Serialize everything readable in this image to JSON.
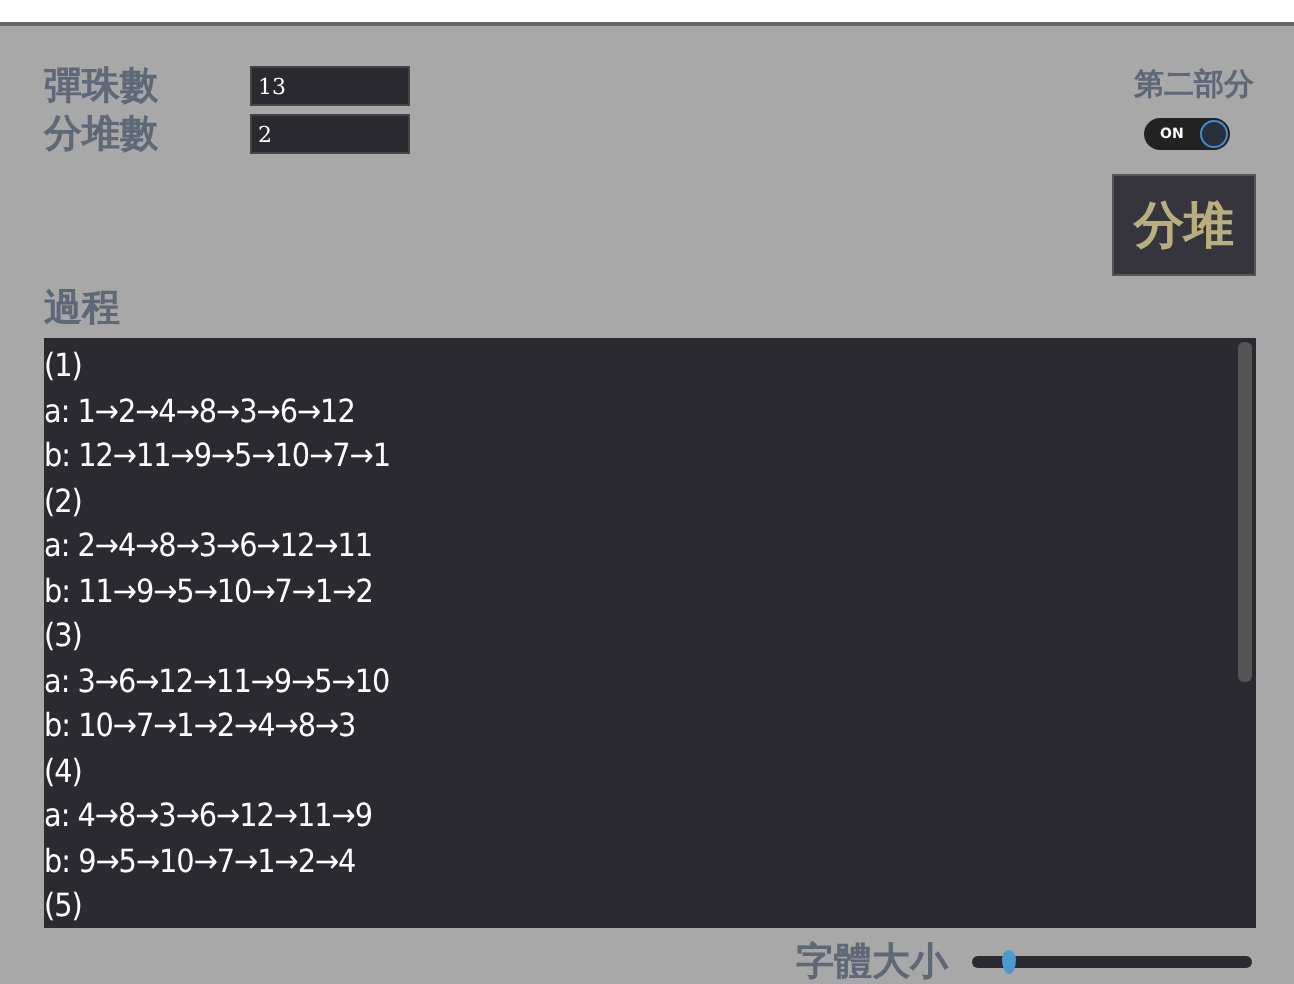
{
  "inputs": [
    {
      "label": "彈珠數",
      "value": "13"
    },
    {
      "label": "分堆數",
      "value": "2"
    }
  ],
  "part_two": {
    "label": "第二部分",
    "toggle_text": "ON",
    "on": true
  },
  "split_button": "分堆",
  "process": {
    "title": "過程",
    "lines": [
      "(1)",
      "a: 1→2→4→8→3→6→12",
      "b: 12→11→9→5→10→7→1",
      "(2)",
      "a: 2→4→8→3→6→12→11",
      "b: 11→9→5→10→7→1→2",
      "(3)",
      "a: 3→6→12→11→9→5→10",
      "b: 10→7→1→2→4→8→3",
      "(4)",
      "a: 4→8→3→6→12→11→9",
      "b: 9→5→10→7→1→2→4",
      "(5)"
    ]
  },
  "font_size": {
    "label": "字體大小",
    "level": 0.13
  }
}
